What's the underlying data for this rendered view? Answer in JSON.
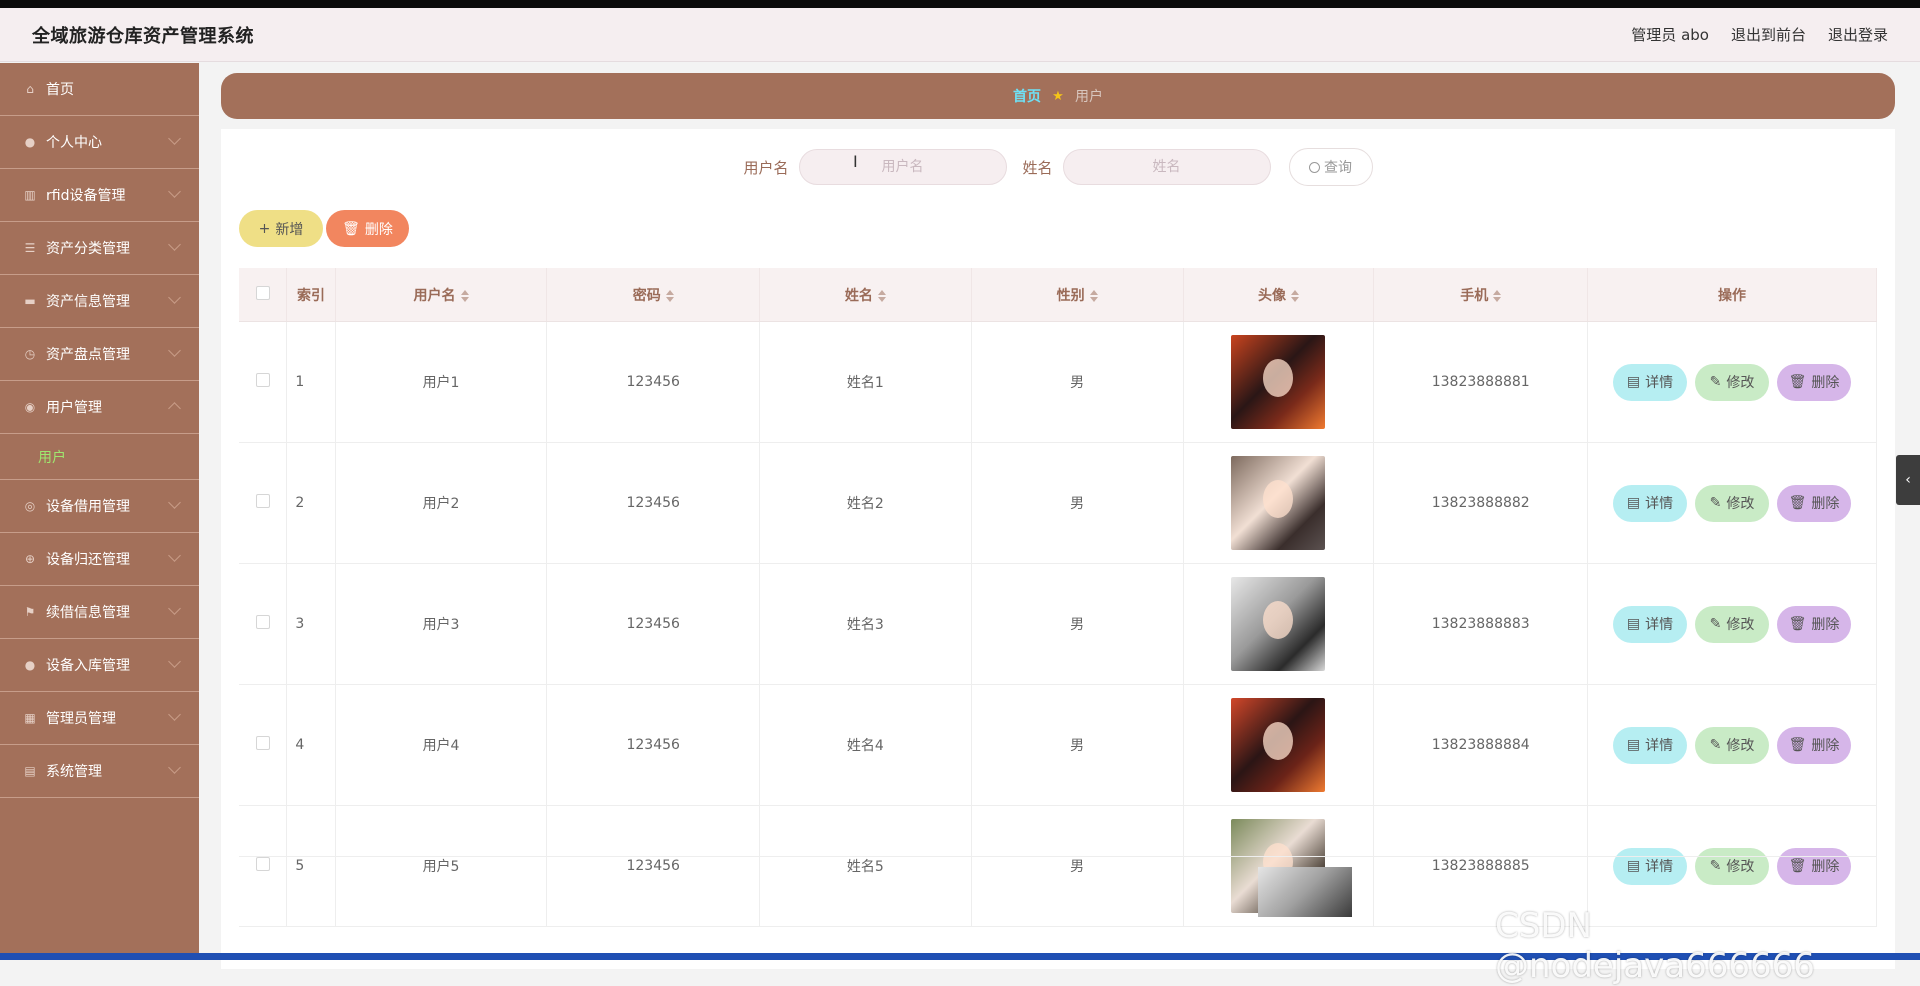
{
  "header": {
    "title": "全域旅游仓库资产管理系统",
    "user": "管理员 abo",
    "to_front": "退出到前台",
    "logout": "退出登录"
  },
  "sidebar": {
    "items": [
      {
        "label": "首页",
        "icon": "home-icon",
        "expandable": false
      },
      {
        "label": "个人中心",
        "icon": "user-icon",
        "expandable": true
      },
      {
        "label": "rfid设备管理",
        "icon": "chart-icon",
        "expandable": true
      },
      {
        "label": "资产分类管理",
        "icon": "list-icon",
        "expandable": true
      },
      {
        "label": "资产信息管理",
        "icon": "briefcase-icon",
        "expandable": true
      },
      {
        "label": "资产盘点管理",
        "icon": "clock-icon",
        "expandable": true
      },
      {
        "label": "用户管理",
        "icon": "location-icon",
        "expandable": true,
        "open": true
      },
      {
        "label": "设备借用管理",
        "icon": "compass-icon",
        "expandable": true
      },
      {
        "label": "设备归还管理",
        "icon": "basketball-icon",
        "expandable": true
      },
      {
        "label": "续借信息管理",
        "icon": "flag-icon",
        "expandable": true
      },
      {
        "label": "设备入库管理",
        "icon": "user-icon",
        "expandable": true
      },
      {
        "label": "管理员管理",
        "icon": "grid-icon",
        "expandable": true
      },
      {
        "label": "系统管理",
        "icon": "data-icon",
        "expandable": true
      }
    ],
    "submenu": {
      "label": "用户"
    }
  },
  "breadcrumb": {
    "home": "首页",
    "current": "用户"
  },
  "search": {
    "username_label": "用户名",
    "username_placeholder": "用户名",
    "name_label": "姓名",
    "name_placeholder": "姓名",
    "query_label": "查询"
  },
  "actions": {
    "add_label": "新增",
    "delete_label": "删除"
  },
  "table": {
    "headers": [
      "索引",
      "用户名",
      "密码",
      "姓名",
      "性别",
      "头像",
      "手机",
      "操作"
    ],
    "rows": [
      {
        "index": "1",
        "username": "用户1",
        "password": "123456",
        "name": "姓名1",
        "gender": "男",
        "phone": "13823888881"
      },
      {
        "index": "2",
        "username": "用户2",
        "password": "123456",
        "name": "姓名2",
        "gender": "男",
        "phone": "13823888882"
      },
      {
        "index": "3",
        "username": "用户3",
        "password": "123456",
        "name": "姓名3",
        "gender": "男",
        "phone": "13823888883"
      },
      {
        "index": "4",
        "username": "用户4",
        "password": "123456",
        "name": "姓名4",
        "gender": "男",
        "phone": "13823888884"
      },
      {
        "index": "5",
        "username": "用户5",
        "password": "123456",
        "name": "姓名5",
        "gender": "男",
        "phone": "13823888885"
      }
    ],
    "row_actions": {
      "detail": "详情",
      "edit": "修改",
      "delete": "删除"
    }
  },
  "watermark": "CSDN @nodejava666666",
  "colors": {
    "sidebar": "#a3705a",
    "accent_link": "#6fe0f5",
    "submenu_active": "#9fe86f"
  }
}
